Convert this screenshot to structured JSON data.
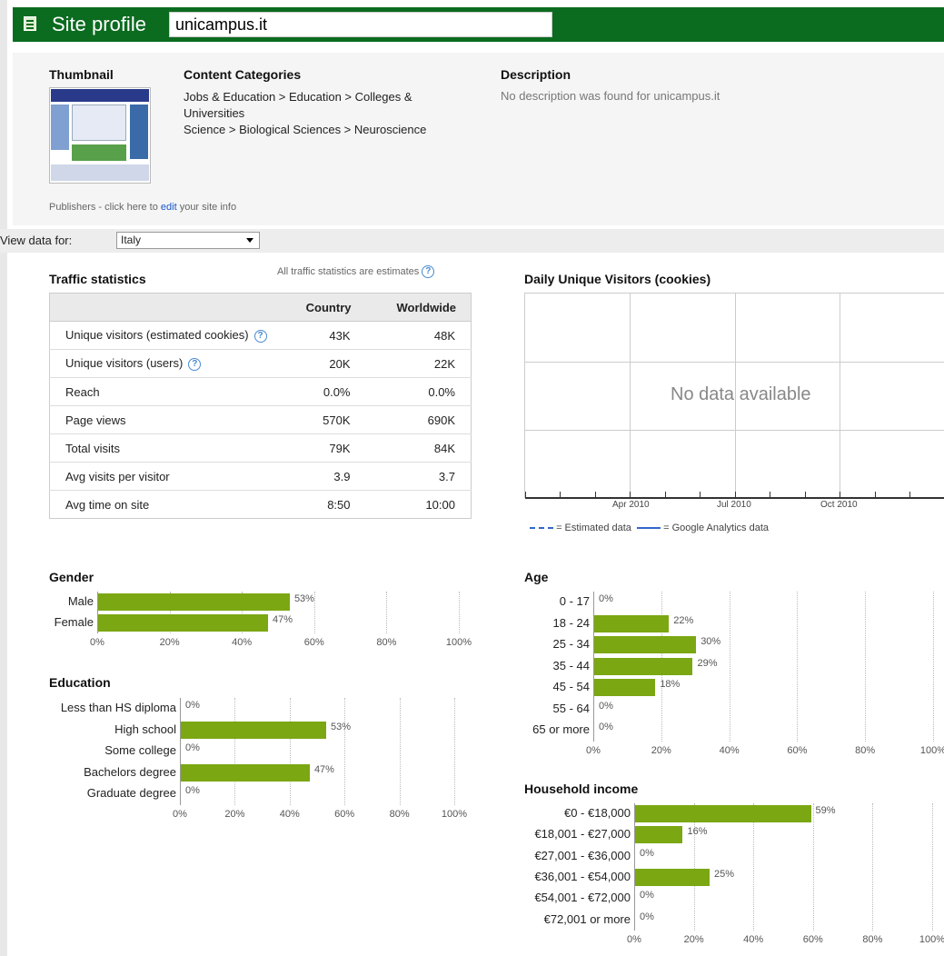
{
  "header": {
    "title": "Site profile",
    "url_value": "unicampus.it"
  },
  "profile": {
    "thumbnail_label": "Thumbnail",
    "content_categories_label": "Content Categories",
    "categories": [
      "Jobs & Education > Education > Colleges & Universities",
      "Science > Biological Sciences > Neuroscience"
    ],
    "description_label": "Description",
    "description_text": "No description was found for unicampus.it",
    "publishers_prefix": "Publishers - click here to ",
    "publishers_link": "edit",
    "publishers_suffix": " your site info"
  },
  "view_data": {
    "label": "View data for:",
    "selected": "Italy"
  },
  "traffic": {
    "title": "Traffic statistics",
    "note": "All traffic statistics are estimates",
    "columns": [
      "Country",
      "Worldwide"
    ],
    "rows": [
      {
        "metric": "Unique visitors (estimated cookies)",
        "help": true,
        "country": "43K",
        "worldwide": "48K"
      },
      {
        "metric": "Unique visitors (users)",
        "help": true,
        "country": "20K",
        "worldwide": "22K"
      },
      {
        "metric": "Reach",
        "help": false,
        "country": "0.0%",
        "worldwide": "0.0%"
      },
      {
        "metric": "Page views",
        "help": false,
        "country": "570K",
        "worldwide": "690K"
      },
      {
        "metric": "Total visits",
        "help": false,
        "country": "79K",
        "worldwide": "84K"
      },
      {
        "metric": "Avg visits per visitor",
        "help": false,
        "country": "3.9",
        "worldwide": "3.7"
      },
      {
        "metric": "Avg time on site",
        "help": false,
        "country": "8:50",
        "worldwide": "10:00"
      }
    ]
  },
  "daily_visitors": {
    "title": "Daily Unique Visitors (cookies)",
    "no_data": "No data available",
    "x_labels": [
      "Apr 2010",
      "Jul 2010",
      "Oct 2010"
    ],
    "legend_estimated": "= Estimated data",
    "legend_analytics": "= Google Analytics data"
  },
  "chart_data": [
    {
      "type": "bar",
      "title": "Gender",
      "categories": [
        "Male",
        "Female"
      ],
      "values": [
        53,
        47
      ],
      "value_labels": [
        "53%",
        "47%"
      ],
      "xlim": [
        0,
        100
      ],
      "x_ticks": [
        "0%",
        "20%",
        "40%",
        "60%",
        "80%",
        "100%"
      ]
    },
    {
      "type": "bar",
      "title": "Education",
      "categories": [
        "Less than HS diploma",
        "High school",
        "Some college",
        "Bachelors degree",
        "Graduate degree"
      ],
      "values": [
        0,
        53,
        0,
        47,
        0
      ],
      "value_labels": [
        "0%",
        "53%",
        "0%",
        "47%",
        "0%"
      ],
      "xlim": [
        0,
        100
      ],
      "x_ticks": [
        "0%",
        "20%",
        "40%",
        "60%",
        "80%",
        "100%"
      ]
    },
    {
      "type": "bar",
      "title": "Age",
      "categories": [
        "0 - 17",
        "18 - 24",
        "25 - 34",
        "35 - 44",
        "45 - 54",
        "55 - 64",
        "65 or more"
      ],
      "values": [
        0,
        22,
        30,
        29,
        18,
        0,
        0
      ],
      "value_labels": [
        "0%",
        "22%",
        "30%",
        "29%",
        "18%",
        "0%",
        "0%"
      ],
      "xlim": [
        0,
        100
      ],
      "x_ticks": [
        "0%",
        "20%",
        "40%",
        "60%",
        "80%",
        "100%"
      ]
    },
    {
      "type": "bar",
      "title": "Household income",
      "categories": [
        "€0 - €18,000",
        "€18,001 - €27,000",
        "€27,001 - €36,000",
        "€36,001 - €54,000",
        "€54,001 - €72,000",
        "€72,001 or more"
      ],
      "values": [
        59,
        16,
        0,
        25,
        0,
        0
      ],
      "value_labels": [
        "59%",
        "16%",
        "0%",
        "25%",
        "0%",
        "0%"
      ],
      "xlim": [
        0,
        100
      ],
      "x_ticks": [
        "0%",
        "20%",
        "40%",
        "60%",
        "80%",
        "100%"
      ]
    }
  ],
  "colors": {
    "header_bg": "#0b6b1f",
    "bar": "#7ba713",
    "link": "#1a55c9"
  }
}
